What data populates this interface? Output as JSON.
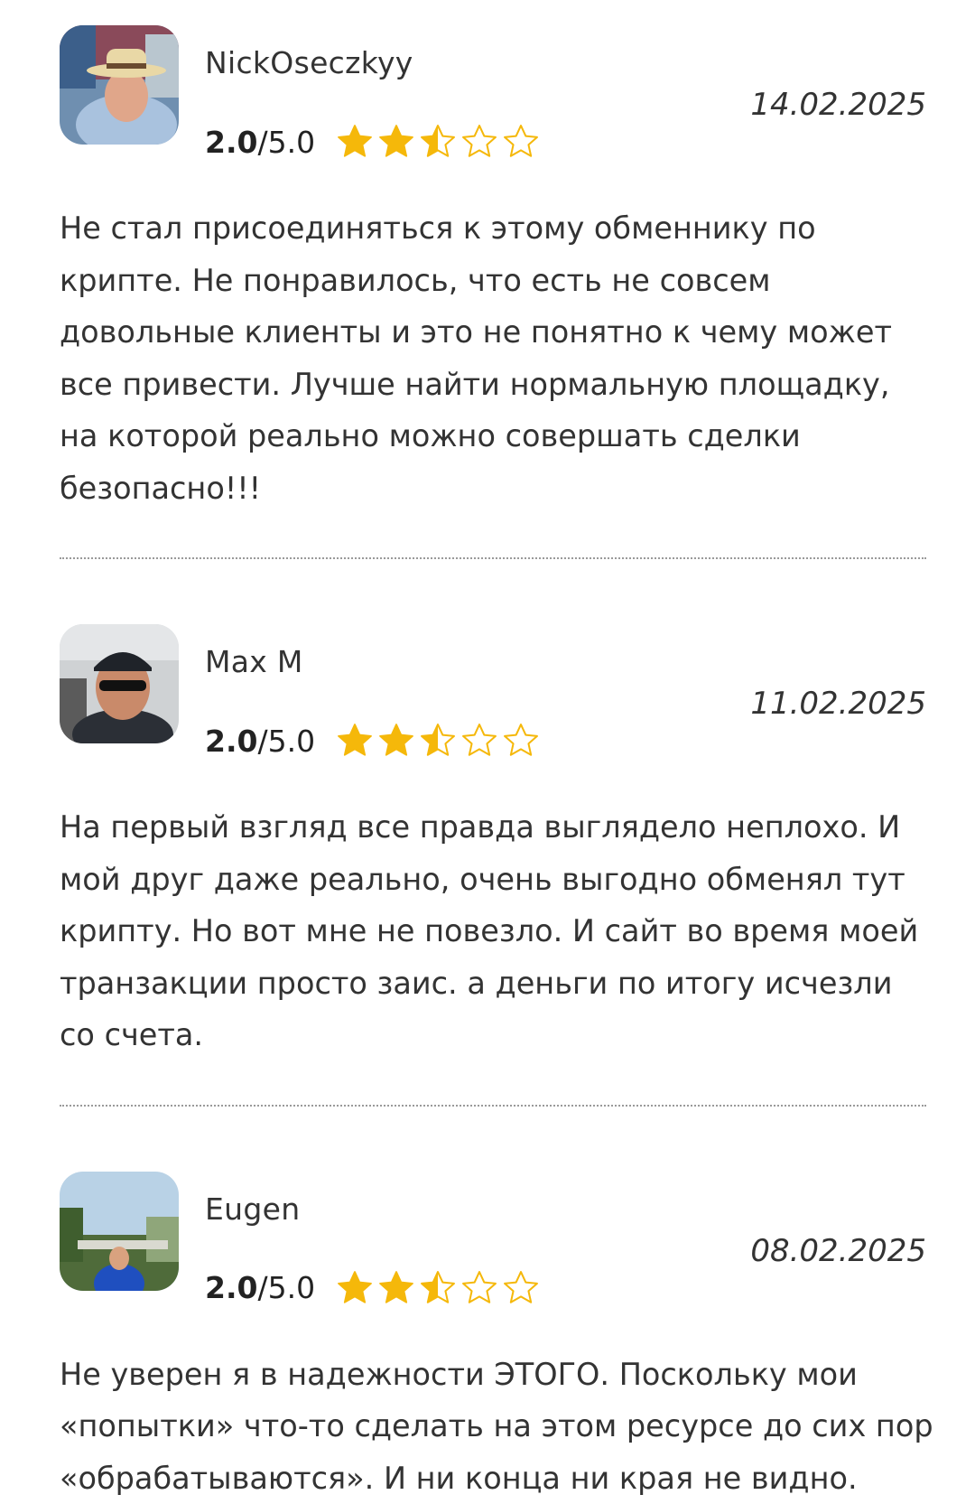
{
  "reviews": [
    {
      "author": "NickOseczkyy",
      "date": "14.02.2025",
      "score": "2.0",
      "max": "/5.0",
      "rating_value": 2.0,
      "text": "Не стал присоединяться к этому обменнику по крипте. Не понравилось, что есть не совсем довольные клиенты и это не понятно к чему может все привести. Лучше найти нормальную площадку, на которой реально можно совершать сделки безопасно!!!"
    },
    {
      "author": "Max M",
      "date": "11.02.2025",
      "score": "2.0",
      "max": "/5.0",
      "rating_value": 2.0,
      "text": "На первый взгляд все правда выглядело неплохо. И мой друг даже реально, очень выгодно обменял тут крипту. Но вот мне не повезло. И сайт во время моей транзакции просто заис. а деньги по итогу исчезли со счета."
    },
    {
      "author": "Eugen",
      "date": "08.02.2025",
      "score": "2.0",
      "max": "/5.0",
      "rating_value": 2.0,
      "text": "Не уверен я в надежности ЭТОГО. Поскольку мои «попытки» что-то сделать на этом ресурсе до сих пор «обрабатываются». И ни конца ни края не видно."
    }
  ],
  "colors": {
    "star_fill": "#f5b80a",
    "star_outline": "#f5b80a",
    "divider": "#9a9a9a",
    "text": "#333333"
  },
  "icons": {
    "full_star": "star-filled-icon",
    "half_star": "star-half-icon",
    "empty_star": "star-outline-icon"
  }
}
